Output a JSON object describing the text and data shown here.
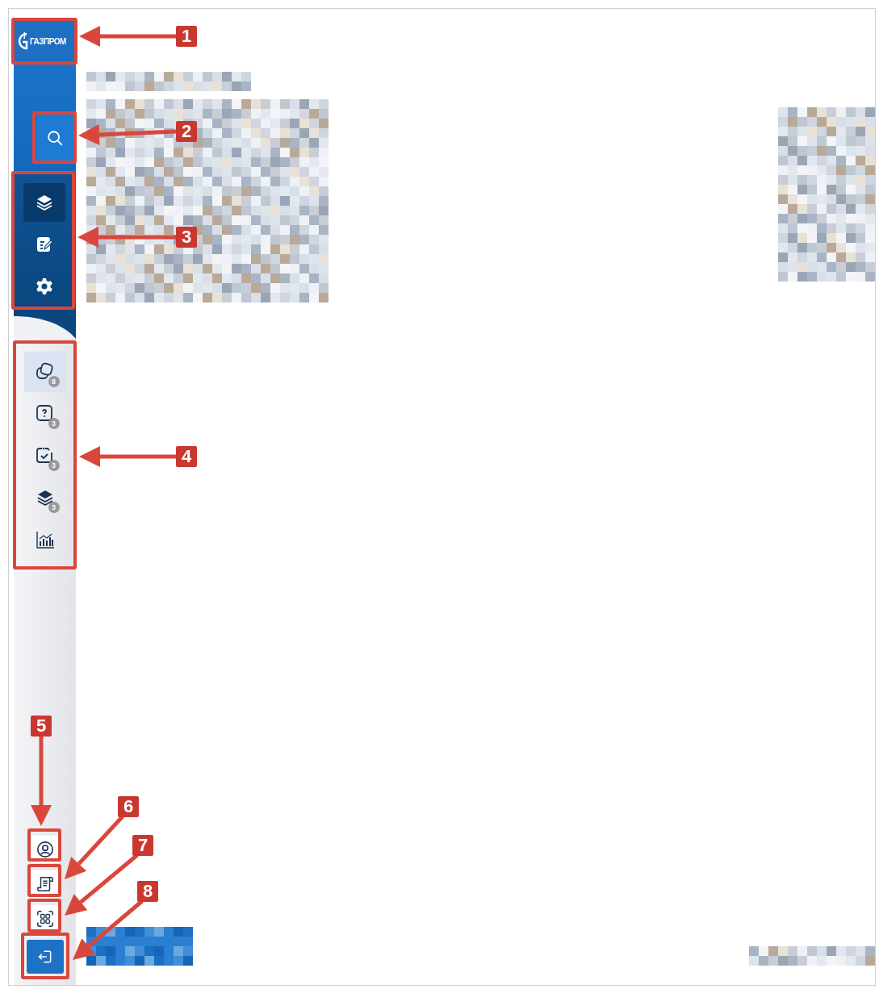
{
  "logo": {
    "text": "ГАЗПРОМ"
  },
  "nav": [
    {
      "kind": "layers",
      "selected": true
    },
    {
      "kind": "edit",
      "selected": false
    },
    {
      "kind": "settings",
      "selected": false
    }
  ],
  "tools": [
    {
      "kind": "shapes",
      "badge": "8",
      "selected": true
    },
    {
      "kind": "question",
      "badge": "3",
      "selected": false
    },
    {
      "kind": "task",
      "badge": "3",
      "selected": false
    },
    {
      "kind": "layers",
      "badge": "3",
      "selected": false
    },
    {
      "kind": "chart",
      "selected": false
    }
  ],
  "footer": [
    {
      "kind": "user"
    },
    {
      "kind": "document"
    },
    {
      "kind": "scan"
    },
    {
      "kind": "logout"
    }
  ],
  "annotations": [
    {
      "label": "1"
    },
    {
      "label": "2"
    },
    {
      "label": "3"
    },
    {
      "label": "4"
    },
    {
      "label": "5"
    },
    {
      "label": "6"
    },
    {
      "label": "7"
    },
    {
      "label": "8"
    }
  ]
}
